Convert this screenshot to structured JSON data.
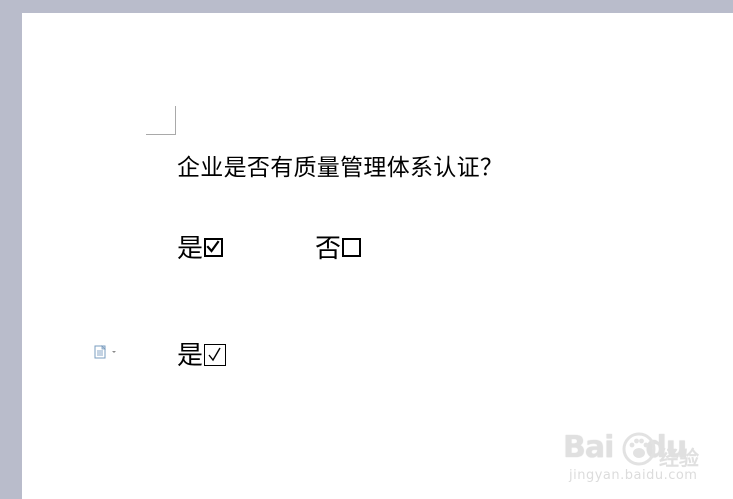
{
  "document": {
    "question": "企业是否有质量管理体系认证？",
    "options": [
      {
        "label": "是",
        "checked": true
      },
      {
        "label": "否",
        "checked": false
      }
    ],
    "example": {
      "label": "是",
      "symbol": "☑"
    }
  },
  "paste_options": {
    "icon": "clipboard-icon"
  },
  "watermark": {
    "brand": "Bai",
    "brand_suffix": "du",
    "product": "经验",
    "url": "jingyan.baidu.com"
  },
  "colors": {
    "workspace_background": "#b9bccb",
    "page_background": "#ffffff",
    "text": "#000000",
    "watermark": "#e0e0e0"
  }
}
